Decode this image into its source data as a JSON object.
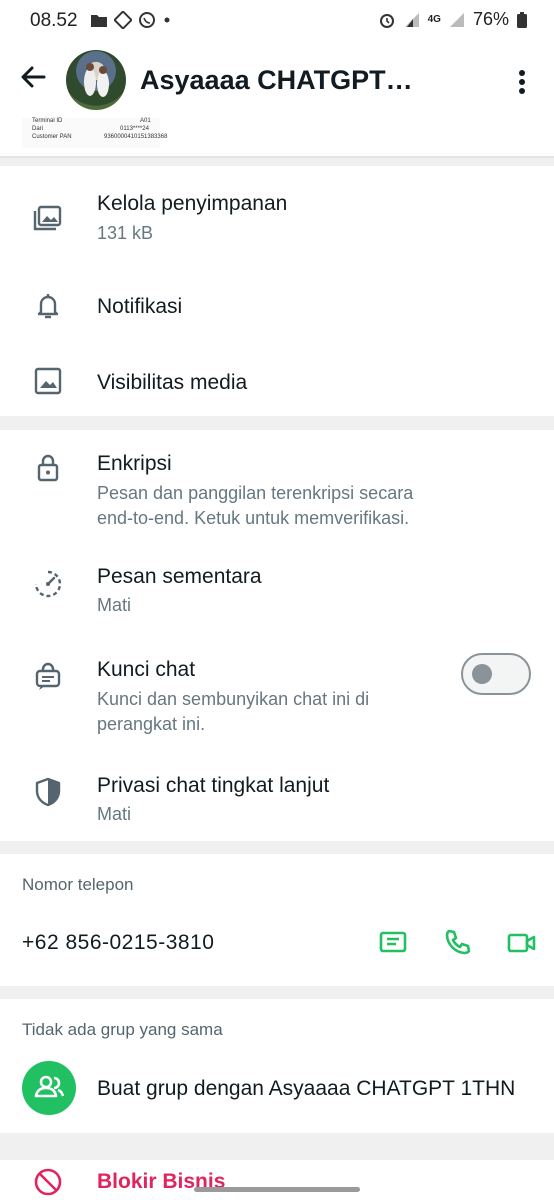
{
  "status_bar": {
    "time": "08.52",
    "battery": "76%",
    "network": "4G"
  },
  "header": {
    "title": "Asyaaaa CHATGPT…"
  },
  "receipt": {
    "line1_label": "Terminal ID",
    "line1_value": "A01",
    "line2_label": "Dari",
    "line2_value": "0113****24",
    "line3_label": "Customer PAN",
    "line3_value": "9360000410151383368"
  },
  "storage": {
    "title": "Kelola penyimpanan",
    "size": "131 kB"
  },
  "notifications": {
    "title": "Notifikasi"
  },
  "media_visibility": {
    "title": "Visibilitas media"
  },
  "encryption": {
    "title": "Enkripsi",
    "line1": "Pesan dan panggilan terenkripsi secara",
    "line2": "end-to-end. Ketuk untuk memverifikasi."
  },
  "disappearing": {
    "title": "Pesan sementara",
    "value": "Mati"
  },
  "chat_lock": {
    "title": "Kunci chat",
    "line1": "Kunci dan sembunyikan chat ini di",
    "line2": "perangkat ini.",
    "enabled": false
  },
  "advanced_privacy": {
    "title": "Privasi chat tingkat lanjut",
    "value": "Mati"
  },
  "phone_section": {
    "label": "Nomor telepon",
    "number": "+62 856-0215-3810"
  },
  "groups_section": {
    "label": "Tidak ada grup yang sama",
    "create_label": "Buat grup dengan Asyaaaa CHATGPT 1THN"
  },
  "block": {
    "label": "Blokir Bisnis"
  },
  "colors": {
    "accent": "#21c063",
    "danger": "#e0245e",
    "text": "#111b21",
    "secondary": "#667781"
  }
}
